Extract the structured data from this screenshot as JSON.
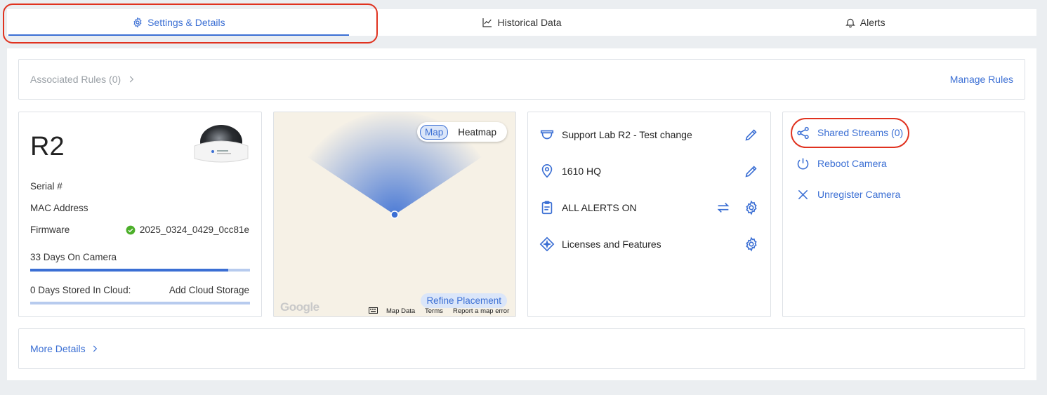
{
  "tabs": [
    {
      "label": "Settings & Details",
      "icon": "gear-icon"
    },
    {
      "label": "Historical Data",
      "icon": "chart-line-icon"
    },
    {
      "label": "Alerts",
      "icon": "bell-icon"
    }
  ],
  "rules": {
    "label": "Associated Rules (0)",
    "manage_label": "Manage Rules"
  },
  "camera": {
    "name": "R2",
    "serial_label": "Serial #",
    "mac_label": "MAC Address",
    "firmware_label": "Firmware",
    "firmware_value": "2025_0324_0429_0cc81e",
    "days_on_camera": "33 Days On Camera",
    "days_on_camera_fraction": 0.9,
    "days_cloud": "0 Days Stored In Cloud:",
    "add_cloud": "Add Cloud Storage"
  },
  "map": {
    "toggle_map": "Map",
    "toggle_heatmap": "Heatmap",
    "refine": "Refine Placement",
    "google": "Google",
    "map_data": "Map Data",
    "terms": "Terms",
    "report": "Report a map error"
  },
  "info": {
    "name": "Support Lab R2 - Test change",
    "location": "1610 HQ",
    "alerts": "ALL ALERTS ON",
    "licenses": "Licenses and Features"
  },
  "actions": {
    "shared_streams": "Shared Streams (0)",
    "reboot": "Reboot Camera",
    "unregister": "Unregister Camera"
  },
  "more": {
    "label": "More Details"
  },
  "colors": {
    "accent": "#3b6fd4",
    "highlight": "#e0321f",
    "ok": "#4caf2a"
  }
}
